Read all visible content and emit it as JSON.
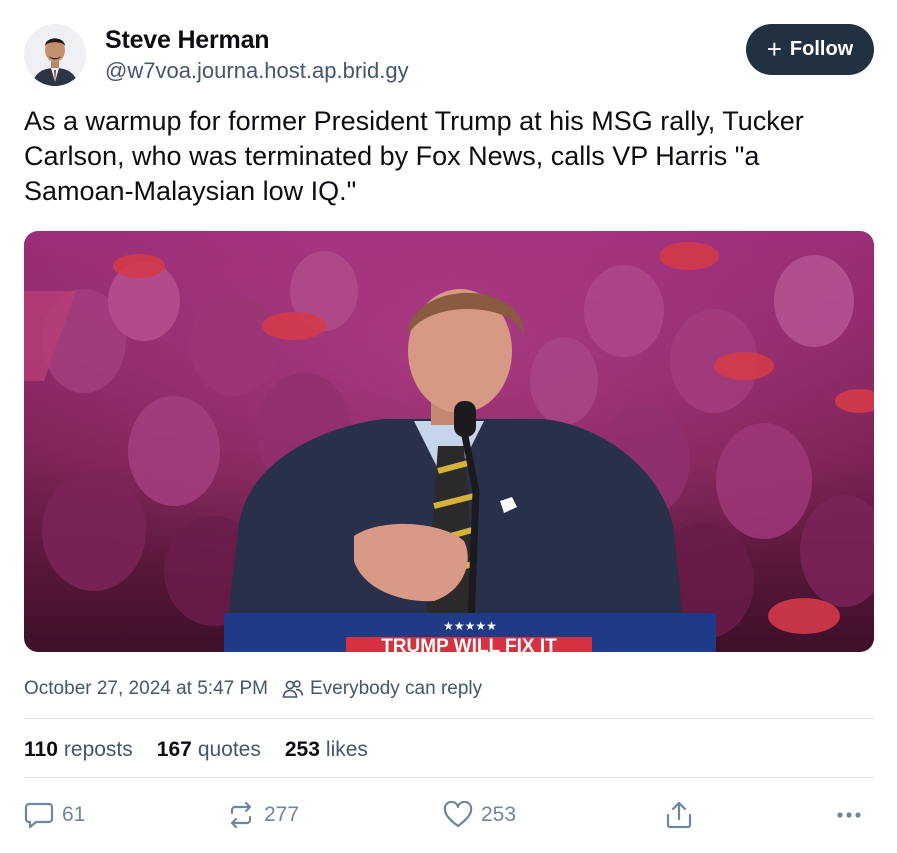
{
  "author": {
    "name": "Steve Herman",
    "handle": "@w7voa.journa.host.ap.brid.gy"
  },
  "follow_button": {
    "label": "Follow",
    "icon": "plus-icon"
  },
  "post": {
    "text": "As a warmup for former President Trump at his MSG rally, Tucker Carlson, who was terminated by Fox News, calls VP Harris \"a Samoan-Malaysian low IQ.\"",
    "image": {
      "podium_stars": "★★★★★",
      "podium_sign": "TRUMP WILL FIX IT"
    }
  },
  "meta": {
    "timestamp": "October 27, 2024 at 5:47 PM",
    "reply_setting": "Everybody can reply"
  },
  "stats": {
    "reposts_count": "110",
    "reposts_label": "reposts",
    "quotes_count": "167",
    "quotes_label": "quotes",
    "likes_count": "253",
    "likes_label": "likes"
  },
  "actions": {
    "reply_count": "61",
    "repost_count": "277",
    "like_count": "253"
  },
  "colors": {
    "follow_bg": "#223142",
    "secondary_text": "#42576c",
    "icon_gray": "#6f869f",
    "divider": "#dfe3e8"
  }
}
